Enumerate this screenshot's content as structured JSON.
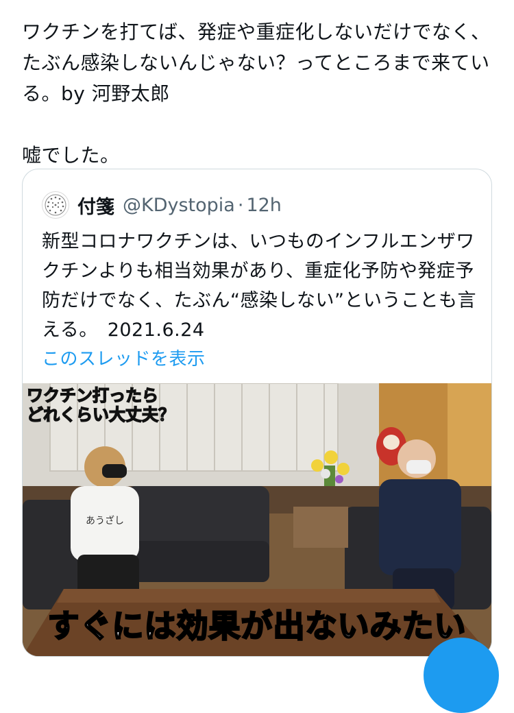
{
  "tweet": {
    "text": "ワクチンを打てば、発症や重症化しないだけでなく、たぶん感染しないんじゃない？ってところまで来ている。by 河野太郎\n\n嘘でした。"
  },
  "quote": {
    "display_name": "付箋",
    "handle": "@KDystopia",
    "separator": "·",
    "time": "12h",
    "text": "新型コロナワクチンは、いつものインフルエンザワクチンよりも相当効果があり、重症化予防や発症予防だけでなく、たぶん“感染しない”ということも言える。　2021.6.24",
    "show_thread": "このスレッドを表示"
  },
  "media": {
    "caption_top_line1": "ワクチン打ったら",
    "caption_top_line2": "どれくらい大丈夫？",
    "subtitle": "すぐには効果が出ないみたい",
    "shirt_text": "あうざし"
  },
  "colors": {
    "link": "#1d9bf0",
    "muted": "#536471",
    "border": "#cfd9de",
    "caption_stroke": "#000000"
  }
}
